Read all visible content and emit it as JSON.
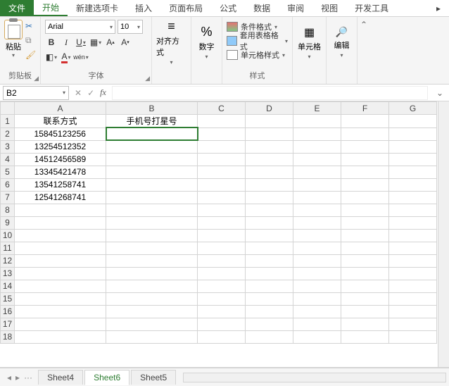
{
  "tabs": {
    "file": "文件",
    "home": "开始",
    "newtab": "新建选项卡",
    "insert": "插入",
    "layout": "页面布局",
    "formula": "公式",
    "data": "数据",
    "review": "审阅",
    "view": "视图",
    "dev": "开发工具"
  },
  "ribbon": {
    "clipboard": {
      "paste": "粘贴",
      "label": "剪贴板"
    },
    "font": {
      "name": "Arial",
      "size": "10",
      "wen": "wén",
      "label": "字体"
    },
    "align": {
      "label": "对齐方式"
    },
    "number": {
      "symbol": "%",
      "label": "数字"
    },
    "styles": {
      "cond": "条件格式",
      "table": "套用表格格式",
      "cell": "单元格样式",
      "label": "样式"
    },
    "cells": {
      "label": "单元格"
    },
    "edit": {
      "label": "编辑"
    }
  },
  "namebox": {
    "value": "B2"
  },
  "columns": [
    "A",
    "B",
    "C",
    "D",
    "E",
    "F",
    "G"
  ],
  "cells": {
    "A1": "联系方式",
    "B1": "手机号打星号",
    "A2": "15845123256",
    "A3": "13254512352",
    "A4": "14512456589",
    "A5": "13345421478",
    "A6": "13541258741",
    "A7": "12541268741"
  },
  "sheets": {
    "s1": "Sheet4",
    "s2": "Sheet6",
    "s3": "Sheet5",
    "dots": "···"
  }
}
